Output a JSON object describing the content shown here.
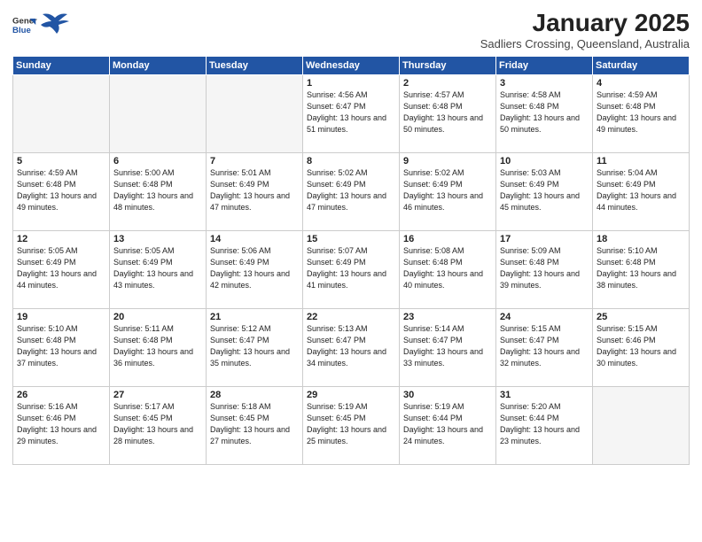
{
  "header": {
    "logo_general": "General",
    "logo_blue": "Blue",
    "title": "January 2025",
    "subtitle": "Sadliers Crossing, Queensland, Australia"
  },
  "days_of_week": [
    "Sunday",
    "Monday",
    "Tuesday",
    "Wednesday",
    "Thursday",
    "Friday",
    "Saturday"
  ],
  "weeks": [
    [
      {
        "day": "",
        "empty": true
      },
      {
        "day": "",
        "empty": true
      },
      {
        "day": "",
        "empty": true
      },
      {
        "day": "1",
        "sunrise": "4:56 AM",
        "sunset": "6:47 PM",
        "daylight": "13 hours and 51 minutes."
      },
      {
        "day": "2",
        "sunrise": "4:57 AM",
        "sunset": "6:48 PM",
        "daylight": "13 hours and 50 minutes."
      },
      {
        "day": "3",
        "sunrise": "4:58 AM",
        "sunset": "6:48 PM",
        "daylight": "13 hours and 50 minutes."
      },
      {
        "day": "4",
        "sunrise": "4:59 AM",
        "sunset": "6:48 PM",
        "daylight": "13 hours and 49 minutes."
      }
    ],
    [
      {
        "day": "5",
        "sunrise": "4:59 AM",
        "sunset": "6:48 PM",
        "daylight": "13 hours and 49 minutes."
      },
      {
        "day": "6",
        "sunrise": "5:00 AM",
        "sunset": "6:48 PM",
        "daylight": "13 hours and 48 minutes."
      },
      {
        "day": "7",
        "sunrise": "5:01 AM",
        "sunset": "6:49 PM",
        "daylight": "13 hours and 47 minutes."
      },
      {
        "day": "8",
        "sunrise": "5:02 AM",
        "sunset": "6:49 PM",
        "daylight": "13 hours and 47 minutes."
      },
      {
        "day": "9",
        "sunrise": "5:02 AM",
        "sunset": "6:49 PM",
        "daylight": "13 hours and 46 minutes."
      },
      {
        "day": "10",
        "sunrise": "5:03 AM",
        "sunset": "6:49 PM",
        "daylight": "13 hours and 45 minutes."
      },
      {
        "day": "11",
        "sunrise": "5:04 AM",
        "sunset": "6:49 PM",
        "daylight": "13 hours and 44 minutes."
      }
    ],
    [
      {
        "day": "12",
        "sunrise": "5:05 AM",
        "sunset": "6:49 PM",
        "daylight": "13 hours and 44 minutes."
      },
      {
        "day": "13",
        "sunrise": "5:05 AM",
        "sunset": "6:49 PM",
        "daylight": "13 hours and 43 minutes."
      },
      {
        "day": "14",
        "sunrise": "5:06 AM",
        "sunset": "6:49 PM",
        "daylight": "13 hours and 42 minutes."
      },
      {
        "day": "15",
        "sunrise": "5:07 AM",
        "sunset": "6:49 PM",
        "daylight": "13 hours and 41 minutes."
      },
      {
        "day": "16",
        "sunrise": "5:08 AM",
        "sunset": "6:48 PM",
        "daylight": "13 hours and 40 minutes."
      },
      {
        "day": "17",
        "sunrise": "5:09 AM",
        "sunset": "6:48 PM",
        "daylight": "13 hours and 39 minutes."
      },
      {
        "day": "18",
        "sunrise": "5:10 AM",
        "sunset": "6:48 PM",
        "daylight": "13 hours and 38 minutes."
      }
    ],
    [
      {
        "day": "19",
        "sunrise": "5:10 AM",
        "sunset": "6:48 PM",
        "daylight": "13 hours and 37 minutes."
      },
      {
        "day": "20",
        "sunrise": "5:11 AM",
        "sunset": "6:48 PM",
        "daylight": "13 hours and 36 minutes."
      },
      {
        "day": "21",
        "sunrise": "5:12 AM",
        "sunset": "6:47 PM",
        "daylight": "13 hours and 35 minutes."
      },
      {
        "day": "22",
        "sunrise": "5:13 AM",
        "sunset": "6:47 PM",
        "daylight": "13 hours and 34 minutes."
      },
      {
        "day": "23",
        "sunrise": "5:14 AM",
        "sunset": "6:47 PM",
        "daylight": "13 hours and 33 minutes."
      },
      {
        "day": "24",
        "sunrise": "5:15 AM",
        "sunset": "6:47 PM",
        "daylight": "13 hours and 32 minutes."
      },
      {
        "day": "25",
        "sunrise": "5:15 AM",
        "sunset": "6:46 PM",
        "daylight": "13 hours and 30 minutes."
      }
    ],
    [
      {
        "day": "26",
        "sunrise": "5:16 AM",
        "sunset": "6:46 PM",
        "daylight": "13 hours and 29 minutes."
      },
      {
        "day": "27",
        "sunrise": "5:17 AM",
        "sunset": "6:45 PM",
        "daylight": "13 hours and 28 minutes."
      },
      {
        "day": "28",
        "sunrise": "5:18 AM",
        "sunset": "6:45 PM",
        "daylight": "13 hours and 27 minutes."
      },
      {
        "day": "29",
        "sunrise": "5:19 AM",
        "sunset": "6:45 PM",
        "daylight": "13 hours and 25 minutes."
      },
      {
        "day": "30",
        "sunrise": "5:19 AM",
        "sunset": "6:44 PM",
        "daylight": "13 hours and 24 minutes."
      },
      {
        "day": "31",
        "sunrise": "5:20 AM",
        "sunset": "6:44 PM",
        "daylight": "13 hours and 23 minutes."
      },
      {
        "day": "",
        "empty": true
      }
    ]
  ]
}
